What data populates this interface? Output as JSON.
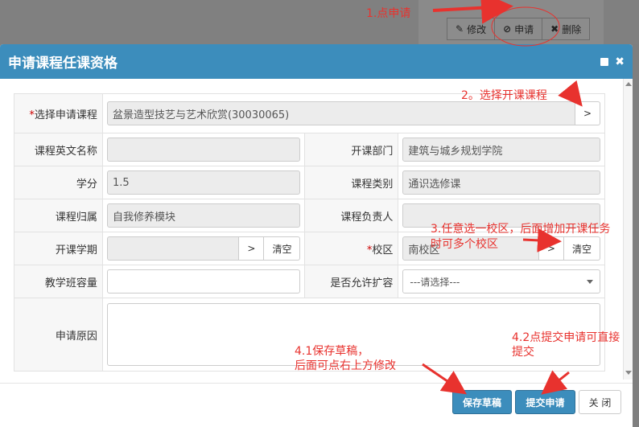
{
  "background": {
    "toolbar": [
      {
        "icon": "edit-icon",
        "glyph": "✎",
        "label": "修改"
      },
      {
        "icon": "ban-icon",
        "glyph": "⊘",
        "label": "申请"
      },
      {
        "icon": "close-icon",
        "glyph": "✖",
        "label": "删除"
      }
    ]
  },
  "dialog": {
    "title": "申请课程任课资格",
    "accent": "#3c8dbc",
    "form": {
      "course": {
        "label": "选择申请课程",
        "required_mark": "*",
        "value": "盆景造型技艺与艺术欣赏(30030065)",
        "pick": ">"
      },
      "english_name": {
        "label": "课程英文名称",
        "value": ""
      },
      "department": {
        "label": "开课部门",
        "value": "建筑与城乡规划学院"
      },
      "credits": {
        "label": "学分",
        "value": "1.5"
      },
      "category": {
        "label": "课程类别",
        "value": "通识选修课"
      },
      "belongs": {
        "label": "课程归属",
        "value": "自我修养模块"
      },
      "leader": {
        "label": "课程负责人",
        "value": ""
      },
      "term": {
        "label": "开课学期",
        "value": "",
        "pick": ">",
        "clear": "清空"
      },
      "campus": {
        "label": "校区",
        "required_mark": "*",
        "value": "南校区",
        "pick": ">",
        "clear": "清空"
      },
      "capacity": {
        "label": "教学班容量",
        "value": ""
      },
      "expand": {
        "label": "是否允许扩容",
        "value": "---请选择---"
      },
      "reason": {
        "label": "申请原因",
        "value": ""
      }
    },
    "footer": {
      "save": "保存草稿",
      "submit": "提交申请",
      "close": "关 闭"
    }
  },
  "annotations": {
    "a1": "1.点申请",
    "a2": "2。选择开课课程",
    "a3_line1": "3.任意选一校区，后面增加开课任务",
    "a3_line2": "时可多个校区",
    "a41_line1": "4.1保存草稿，",
    "a41_line2": "后面可点右上方修改",
    "a42_line1": "4.2点提交申请可直接",
    "a42_line2": "提交",
    "color": "#e8322e"
  }
}
